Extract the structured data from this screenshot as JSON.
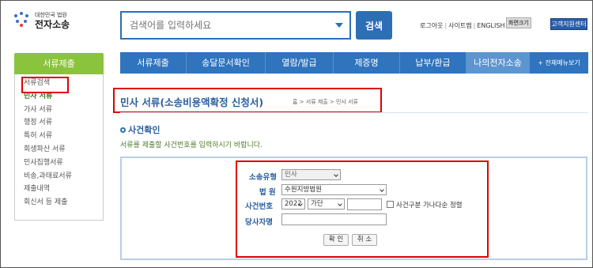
{
  "logo": {
    "small": "대한민국 법원",
    "big": "전자소송"
  },
  "search": {
    "placeholder": "검색어를 입력하세요",
    "button": "검색"
  },
  "util": {
    "logout": "로그아웃",
    "sitemap": "사이트맵",
    "english": "ENGLISH",
    "zoom_label": "화면크기",
    "zoom_in": "+",
    "zoom_out": "-",
    "help": "고객지원센터"
  },
  "sidebar": {
    "header": "서류제출",
    "items": [
      "서류검색",
      "민사 서류",
      "가사 서류",
      "행정 서류",
      "특허 서류",
      "회생파산 서류",
      "민사집행서류",
      "비송,과태료서류",
      "제출내역",
      "회신서 등 제출"
    ]
  },
  "nav": {
    "items": [
      "서류제출",
      "송달문서확인",
      "열람/발급",
      "제증명",
      "납부/환급",
      "나의전자소송"
    ],
    "all_menu": "+ 전체메뉴보기"
  },
  "page": {
    "title": "민사 서류(소송비용액확정 신청서)",
    "breadcrumb": "홈 > 서류 제출 > 민사 서류",
    "section": "사건확인",
    "instruction": "서류를 제출할 사건번호를 입력하시기 바랍니다."
  },
  "form": {
    "type_label": "소송유형",
    "type_value": "민사",
    "court_label": "법 원",
    "court_value": "수원지방법원",
    "case_label": "사건번호",
    "year_value": "2022",
    "kind_value": "가단",
    "sort_label": "사건구분 가나다순 정렬",
    "party_label": "당사자명",
    "confirm": "확 인",
    "cancel": "취 소"
  },
  "colors": {
    "primary": "#2f74bd",
    "green": "#8ac33c",
    "highlight": "#e10000"
  }
}
